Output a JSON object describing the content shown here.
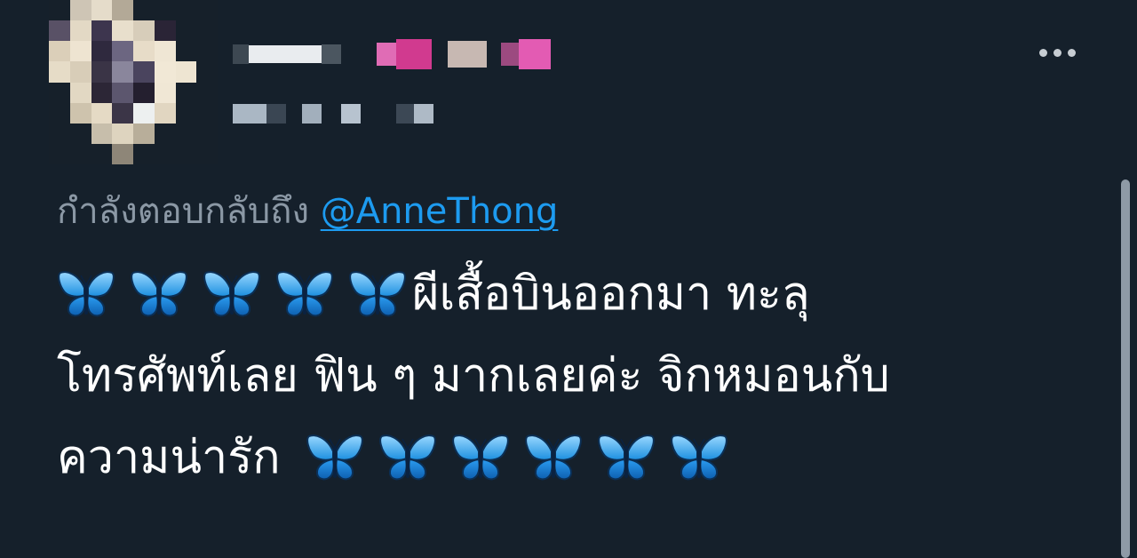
{
  "tweet": {
    "reply_prefix": "กำลังตอบกลับถึง",
    "reply_handle": "@AnneThong",
    "line1": "ผีเสื้อบินออกมา ทะลุ",
    "line2": "โทรศัพท์เลย ฟิน ๆ มากเลยค่ะ จิกหมอนกับ",
    "line3": "ความน่ารัก",
    "emoji": "butterfly"
  },
  "colors": {
    "background": "#15202b",
    "accent": "#1d9bf0",
    "secondary_text": "#8b98a5"
  },
  "icons": [
    "more-options-icon",
    "butterfly-emoji"
  ]
}
